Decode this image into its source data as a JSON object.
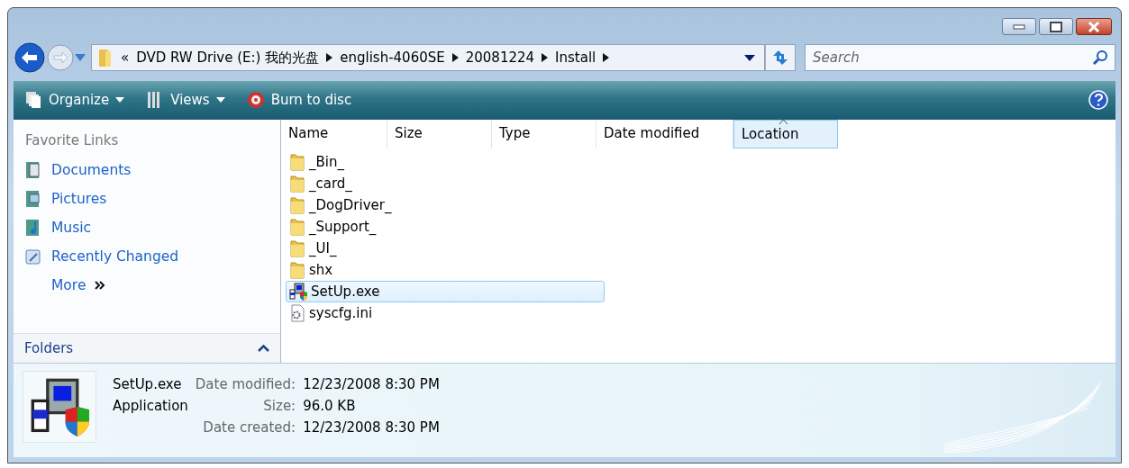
{
  "address": {
    "overflow": "«",
    "segments": [
      "DVD RW Drive (E:) 我的光盘",
      "english-4060SE",
      "20081224",
      "Install"
    ]
  },
  "search": {
    "placeholder": "Search"
  },
  "toolbar": [
    {
      "kind": "organize",
      "label": "Organize"
    },
    {
      "kind": "views",
      "label": "Views"
    },
    {
      "kind": "burn",
      "label": "Burn to disc"
    }
  ],
  "sidebar": {
    "heading": "Favorite Links",
    "items": [
      {
        "kind": "documents",
        "label": "Documents"
      },
      {
        "kind": "pictures",
        "label": "Pictures"
      },
      {
        "kind": "music",
        "label": "Music"
      },
      {
        "kind": "recent",
        "label": "Recently Changed"
      },
      {
        "kind": "more",
        "label": "More"
      }
    ],
    "folders": "Folders"
  },
  "columns": [
    {
      "label": "Name",
      "selected": false
    },
    {
      "label": "Size",
      "selected": false
    },
    {
      "label": "Type",
      "selected": false
    },
    {
      "label": "Date modified",
      "selected": false
    },
    {
      "label": "Location",
      "selected": true
    }
  ],
  "files": [
    {
      "kind": "folder",
      "name": "_Bin_",
      "selected": false
    },
    {
      "kind": "folder",
      "name": "_card_",
      "selected": false
    },
    {
      "kind": "folder",
      "name": "_DogDriver_",
      "selected": false
    },
    {
      "kind": "folder",
      "name": "_Support_",
      "selected": false
    },
    {
      "kind": "folder",
      "name": "_UI_",
      "selected": false
    },
    {
      "kind": "folder",
      "name": "shx",
      "selected": false
    },
    {
      "kind": "exe",
      "name": "SetUp.exe",
      "selected": true
    },
    {
      "kind": "ini",
      "name": "syscfg.ini",
      "selected": false
    }
  ],
  "details": {
    "name": "SetUp.exe",
    "type": "Application",
    "properties": [
      {
        "label": "Date modified:",
        "value": "12/23/2008 8:30 PM"
      },
      {
        "label": "Size:",
        "value": "96.0 KB"
      },
      {
        "label": "Date created:",
        "value": "12/23/2008 8:30 PM"
      }
    ]
  }
}
